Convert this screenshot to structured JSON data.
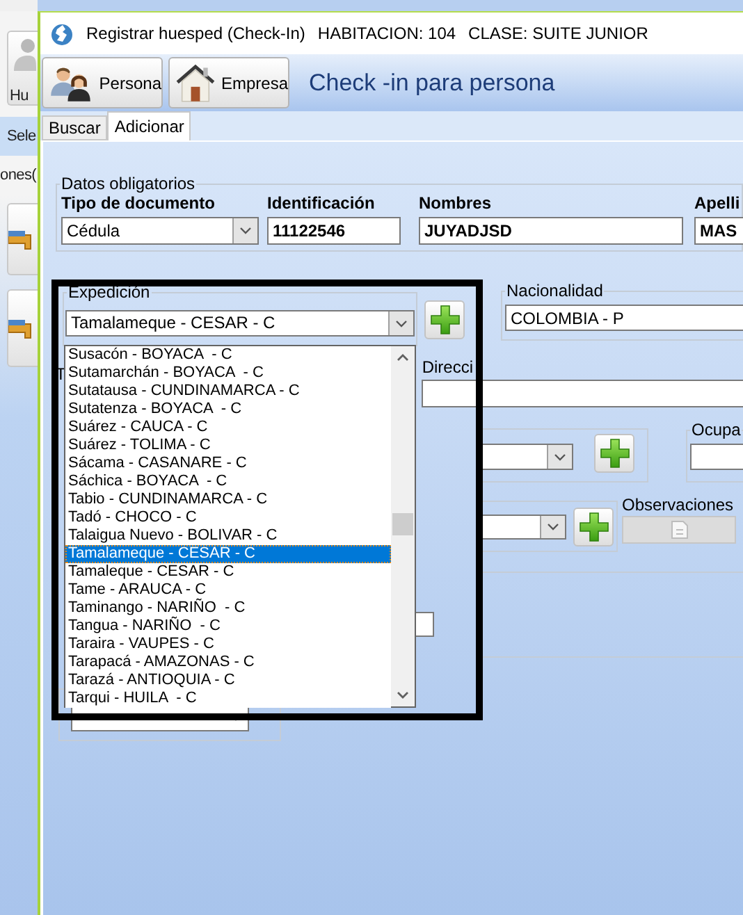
{
  "background_app": {
    "toolbar_button": "Hu",
    "selector_label": "Sele",
    "column_text": "ones("
  },
  "window": {
    "title": "Registrar huesped (Check-In)",
    "room": "HABITACION: 104",
    "room_class": "CLASE: SUITE JUNIOR"
  },
  "header": {
    "buttons": [
      {
        "label": "Persona",
        "kind": "people"
      },
      {
        "label": "Empresa",
        "kind": "house"
      }
    ],
    "heading": "Check -in para persona"
  },
  "tabs": [
    {
      "label": "Buscar",
      "selected": false
    },
    {
      "label": "Adicionar",
      "selected": true
    }
  ],
  "required_data": {
    "title": "Datos obligatorios",
    "fields": [
      {
        "label": "Tipo de documento",
        "value": "Cédula",
        "kind": "combo"
      },
      {
        "label": "Identificación",
        "value": "11122546",
        "kind": "text"
      },
      {
        "label": "Nombres",
        "value": "JUYADJSD",
        "kind": "text"
      },
      {
        "label": "Apelli",
        "value": "MAS",
        "kind": "text"
      }
    ]
  },
  "expedicion": {
    "title": "Expedición",
    "value": "Tamalameque - CESAR - C",
    "options": [
      {
        "label": "Susacón - BOYACA  - C",
        "selected": false
      },
      {
        "label": "Sutamarchán - BOYACA  - C",
        "selected": false
      },
      {
        "label": "Sutatausa - CUNDINAMARCA - C",
        "selected": false
      },
      {
        "label": "Sutatenza - BOYACA  - C",
        "selected": false
      },
      {
        "label": "Suárez - CAUCA - C",
        "selected": false
      },
      {
        "label": "Suárez - TOLIMA - C",
        "selected": false
      },
      {
        "label": "Sácama - CASANARE - C",
        "selected": false
      },
      {
        "label": "Sáchica - BOYACA  - C",
        "selected": false
      },
      {
        "label": "Tabio - CUNDINAMARCA - C",
        "selected": false
      },
      {
        "label": "Tadó - CHOCO - C",
        "selected": false
      },
      {
        "label": "Talaigua Nuevo - BOLIVAR - C",
        "selected": false
      },
      {
        "label": "Tamalameque - CESAR - C",
        "selected": true
      },
      {
        "label": "Tamaleque - CESAR - C",
        "selected": false
      },
      {
        "label": "Tame - ARAUCA - C",
        "selected": false
      },
      {
        "label": "Taminango - NARIÑO  - C",
        "selected": false
      },
      {
        "label": "Tangua - NARIÑO  - C",
        "selected": false
      },
      {
        "label": "Taraira - VAUPES - C",
        "selected": false
      },
      {
        "label": "Tarapacá - AMAZONAS - C",
        "selected": false
      },
      {
        "label": "Tarazá - ANTIOQUIA - C",
        "selected": false
      },
      {
        "label": "Tarqui - HUILA  - C",
        "selected": false
      }
    ]
  },
  "nacionalidad": {
    "title": "Nacionalidad",
    "value": "COLOMBIA - P"
  },
  "partial_label": "T",
  "direccion": {
    "label": "Direcci"
  },
  "ocupacion": {
    "title": "Ocupa"
  },
  "observaciones": {
    "label": "Observaciones"
  }
}
